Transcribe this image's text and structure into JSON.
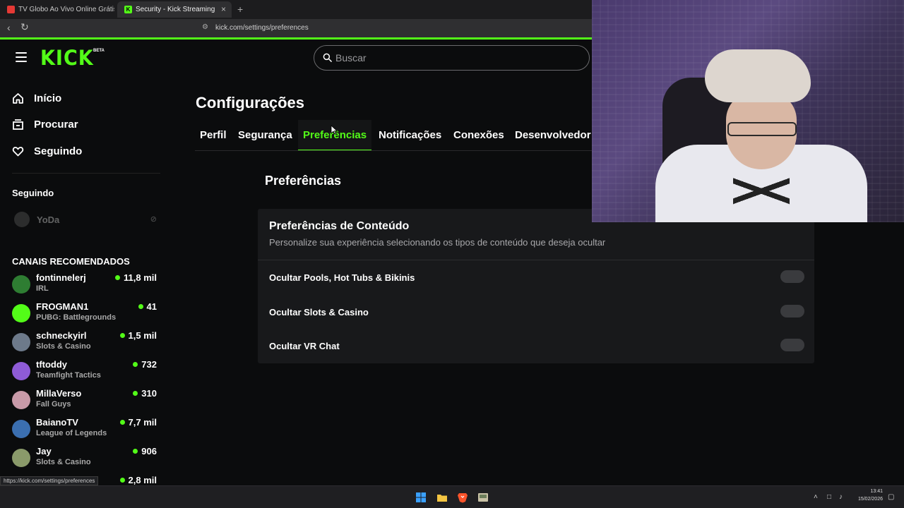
{
  "browser": {
    "tabs": [
      {
        "title": "TV Globo Ao Vivo Online Grátis | Assi"
      },
      {
        "title": "Security - Kick Streaming",
        "active": true
      }
    ],
    "new_tab": "+",
    "close": "×",
    "url": "kick.com/settings/preferences",
    "status_url": "https://kick.com/settings/preferences"
  },
  "header": {
    "logo": "KICK",
    "beta": "BETA",
    "search_placeholder": "Buscar"
  },
  "sidebar": {
    "nav": [
      {
        "label": "Início",
        "icon": "home-icon"
      },
      {
        "label": "Procurar",
        "icon": "browse-icon"
      },
      {
        "label": "Seguindo",
        "icon": "heart-icon"
      }
    ],
    "following_heading": "Seguindo",
    "following": [
      {
        "name": "YoDa",
        "status": "offline"
      }
    ],
    "recommended_heading": "CANAIS RECOMENDADOS",
    "recommended": [
      {
        "name": "fontinnelerj",
        "category": "IRL",
        "viewers": "11,8 mil",
        "avatar_color": "#2e7d32"
      },
      {
        "name": "FROGMAN1",
        "category": "PUBG: Battlegrounds",
        "viewers": "41",
        "avatar_color": "#53fc18"
      },
      {
        "name": "schneckyirl",
        "category": "Slots & Casino",
        "viewers": "1,5 mil",
        "avatar_color": "#6d7a8a"
      },
      {
        "name": "tftoddy",
        "category": "Teamfight Tactics",
        "viewers": "732",
        "avatar_color": "#8e5bd6"
      },
      {
        "name": "MillaVerso",
        "category": "Fall Guys",
        "viewers": "310",
        "avatar_color": "#c89aa8"
      },
      {
        "name": "BaianoTV",
        "category": "League of Legends",
        "viewers": "7,7 mil",
        "avatar_color": "#3b6fb0"
      },
      {
        "name": "Jay",
        "category": "Slots & Casino",
        "viewers": "906",
        "avatar_color": "#8a9a6a"
      },
      {
        "name": "",
        "category": "",
        "viewers": "2,8 mil",
        "avatar_color": "#555555"
      }
    ]
  },
  "settings": {
    "title": "Configurações",
    "tabs": [
      "Perfil",
      "Segurança",
      "Preferências",
      "Notificações",
      "Conexões",
      "Desenvolvedor"
    ],
    "active_tab": "Preferências",
    "section_title": "Preferências",
    "card": {
      "title": "Preferências de Conteúdo",
      "subtitle": "Personalize sua experiência selecionando os tipos de conteúdo que deseja ocultar",
      "options": [
        {
          "label": "Ocultar Pools, Hot Tubs & Bikinis",
          "enabled": false
        },
        {
          "label": "Ocultar Slots & Casino",
          "enabled": false
        },
        {
          "label": "Ocultar VR Chat",
          "enabled": false
        }
      ]
    }
  },
  "taskbar": {
    "time": "13:41",
    "date": "15/02/2026"
  },
  "colors": {
    "accent": "#53fc18",
    "background": "#0b0c0d",
    "card": "#18191b"
  }
}
